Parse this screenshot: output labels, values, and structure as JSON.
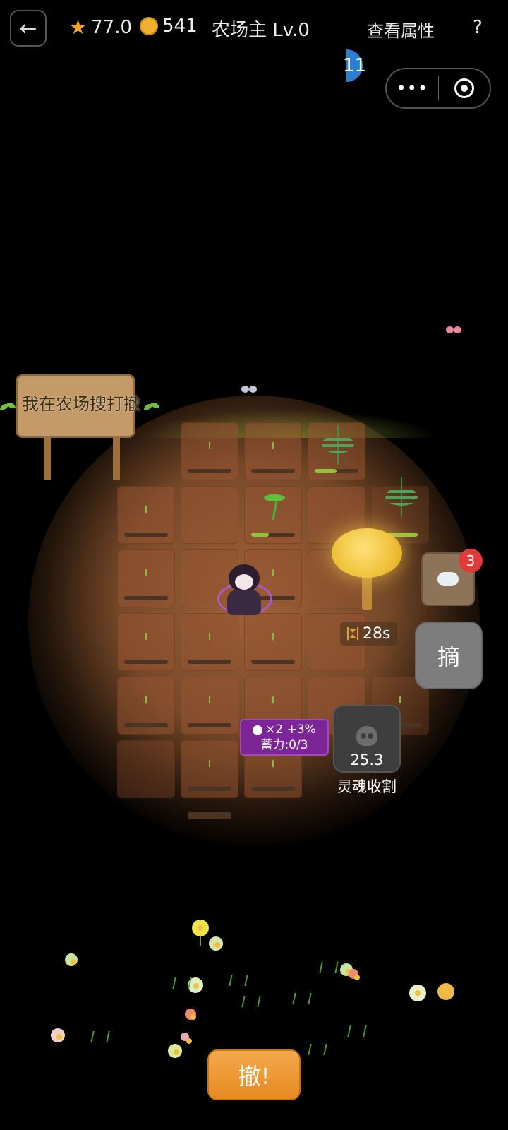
{
  "header": {
    "back_icon": "back-arrow-icon",
    "star_icon": "star-icon",
    "stars": "77.0",
    "coin_icon": "coin-icon",
    "coins": "541",
    "title": "农场主 Lv.0",
    "view_attributes": "查看属性",
    "help": "?"
  },
  "level_indicator": {
    "value": "11",
    "fill_fraction": 0.5,
    "color": "#2a7fd0"
  },
  "capsule": {
    "more_icon": "more-dots-icon",
    "more_label": "•••",
    "close_icon": "target-icon"
  },
  "farm": {
    "sign_text": "我在农场搜打撤",
    "tree_timer": "28s",
    "growth_progress": [
      0.5,
      0.4,
      0.9
    ]
  },
  "side": {
    "bag_badge": "3",
    "bag_icon": "cloud-bag-icon",
    "pick_label": "摘"
  },
  "skill": {
    "buff_line1": "×2 +3%",
    "buff_line2": "蓄力:0/3",
    "card_value": "25.3",
    "card_label": "灵魂收割",
    "card_icon": "skull-icon"
  },
  "bottom": {
    "action_label": "撤!"
  },
  "colors": {
    "accent_orange": "#e58a22",
    "buff_purple": "#7b2596",
    "badge_red": "#e23a3a"
  }
}
